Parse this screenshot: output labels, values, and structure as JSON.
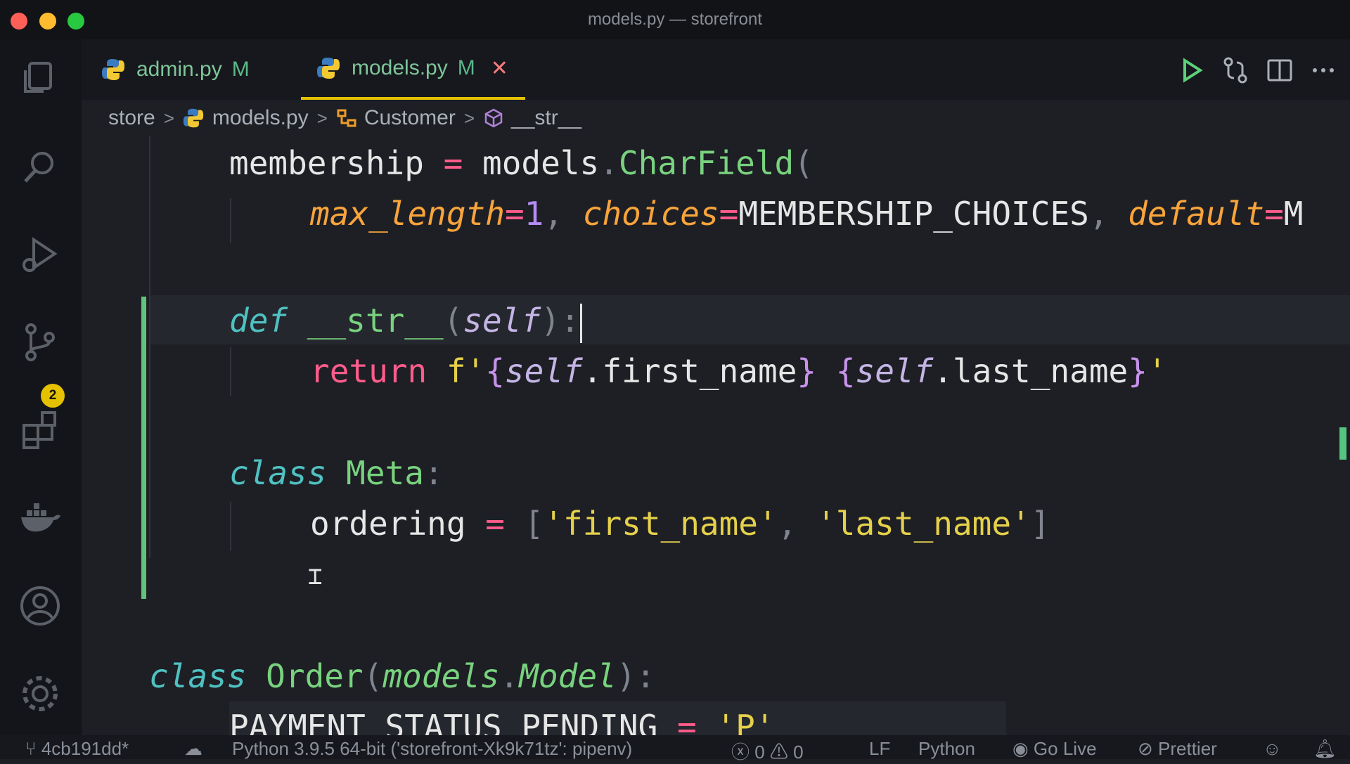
{
  "window": {
    "title": "models.py — storefront"
  },
  "activity_bar": {
    "scm_badge": "2"
  },
  "tabs": [
    {
      "label": "admin.py",
      "status": "M"
    },
    {
      "label": "models.py",
      "status": "M",
      "close": "✕"
    }
  ],
  "breadcrumb": {
    "folder": "store",
    "file": "models.py",
    "class": "Customer",
    "method": "__str__",
    "sep": ">"
  },
  "code": {
    "l1": {
      "a": "membership",
      "b": " = ",
      "c": "models",
      "d": ".",
      "e": "CharField",
      "f": "("
    },
    "l2": {
      "a": "max_length",
      "b": "=",
      "c": "1",
      "d": ", ",
      "e": "choices",
      "f": "=",
      "g": "MEMBERSHIP_CHOICES",
      "h": ", ",
      "i": "default",
      "j": "=",
      "k": "M"
    },
    "l3": {
      "a": "def",
      "b": " __str__",
      "c": "(",
      "d": "self",
      "e": "):"
    },
    "l4": {
      "a": "return",
      "b": " f'",
      "c": "{",
      "d": "self",
      "e": ".first_name",
      "f": "}",
      "g": " ",
      "h": "{",
      "i": "self",
      "j": ".last_name",
      "k": "}",
      "l": "'"
    },
    "l5": {
      "a": "class",
      "b": " Meta",
      "c": ":"
    },
    "l6": {
      "a": "ordering",
      "b": " = ",
      "c": "[",
      "d": "'first_name'",
      "e": ", ",
      "f": "'last_name'",
      "g": "]"
    },
    "l7": {
      "a": "class",
      "b": " Order",
      "c": "(",
      "d": "models",
      "e": ".",
      "f": "Model",
      "g": "):"
    },
    "l8": {
      "a": "PAYMENT_STATUS_PENDING",
      "b": " = ",
      "c": "'P'"
    }
  },
  "status": {
    "branch": "4cb191dd*",
    "interpreter": "Python 3.9.5 64-bit ('storefront-Xk9k71tz': pipenv)",
    "errors": "0",
    "warnings": "0",
    "eol": "LF",
    "language": "Python",
    "golive": "Go Live",
    "prettier": "Prettier"
  }
}
